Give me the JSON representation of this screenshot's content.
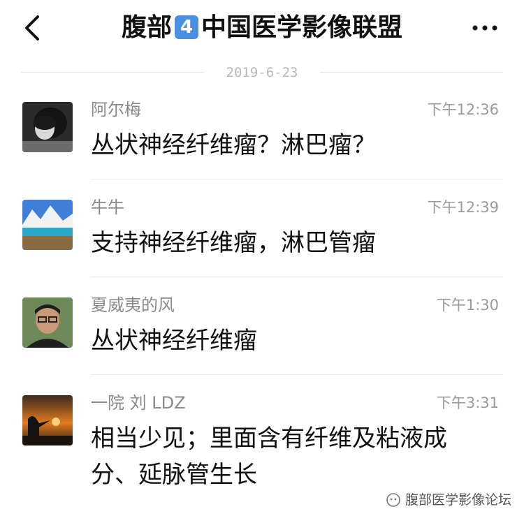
{
  "header": {
    "title_part1": "腹部",
    "title_badge": "4",
    "title_part2": "中国医学影像联盟"
  },
  "date_divider": "2019-6-23",
  "messages": [
    {
      "sender": "阿尔梅",
      "time": "下午12:36",
      "text": "丛状神经纤维瘤？淋巴瘤？"
    },
    {
      "sender": "牛牛",
      "time": "下午12:39",
      "text": "支持神经纤维瘤，淋巴管瘤"
    },
    {
      "sender": "夏威夷的风",
      "time": "下午1:30",
      "text": "丛状神经纤维瘤"
    },
    {
      "sender": "一院 刘 LDZ",
      "time": "下午3:31",
      "text_line1": "相当少见；里面含有纤维及粘液成",
      "text_line2": "分、延脉管生长"
    }
  ],
  "watermark": "腹部医学影像论坛",
  "colors": {
    "badge": "#4a90e2",
    "separator": "#ececec"
  }
}
